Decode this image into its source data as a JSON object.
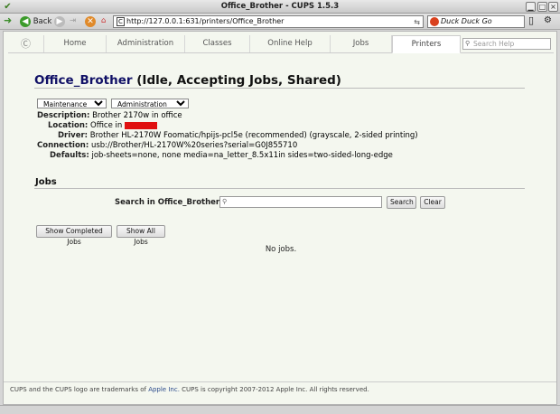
{
  "window": {
    "title": "Office_Brother - CUPS 1.5.3"
  },
  "browser": {
    "back_label": "Back",
    "url": "http://127.0.0.1:631/printers/Office_Brother",
    "search_engine": "Duck Duck Go"
  },
  "tabs": [
    {
      "label": "Home"
    },
    {
      "label": "Administration"
    },
    {
      "label": "Classes"
    },
    {
      "label": "Online Help"
    },
    {
      "label": "Jobs"
    },
    {
      "label": "Printers"
    }
  ],
  "help_search": {
    "placeholder": "Search Help"
  },
  "printer": {
    "name": "Office_Brother",
    "status": "(Idle, Accepting Jobs, Shared)",
    "maintenance_select": "Maintenance",
    "administration_select": "Administration",
    "fields": [
      {
        "key": "Description:",
        "value": "Brother 2170w in office"
      },
      {
        "key": "Location:",
        "value": "Office in"
      },
      {
        "key": "Driver:",
        "value": "Brother HL-2170W Foomatic/hpijs-pcl5e (recommended) (grayscale, 2-sided printing)"
      },
      {
        "key": "Connection:",
        "value": "usb://Brother/HL-2170W%20series?serial=G0J855710"
      },
      {
        "key": "Defaults:",
        "value": "job-sheets=none, none media=na_letter_8.5x11in sides=two-sided-long-edge"
      }
    ]
  },
  "jobs": {
    "heading": "Jobs",
    "search_label": "Search in Office_Brother:",
    "search_button": "Search",
    "clear_button": "Clear",
    "show_completed_button": "Show Completed Jobs",
    "show_all_button": "Show All Jobs",
    "empty_text": "No jobs."
  },
  "footer": {
    "prefix": "CUPS and the CUPS logo are trademarks of ",
    "link": "Apple Inc.",
    "suffix": " CUPS is copyright 2007-2012 Apple Inc. All rights reserved."
  },
  "colors": {
    "page_bg": "#f4f7ef",
    "printer_name": "#101066",
    "redaction": "#e01010"
  }
}
